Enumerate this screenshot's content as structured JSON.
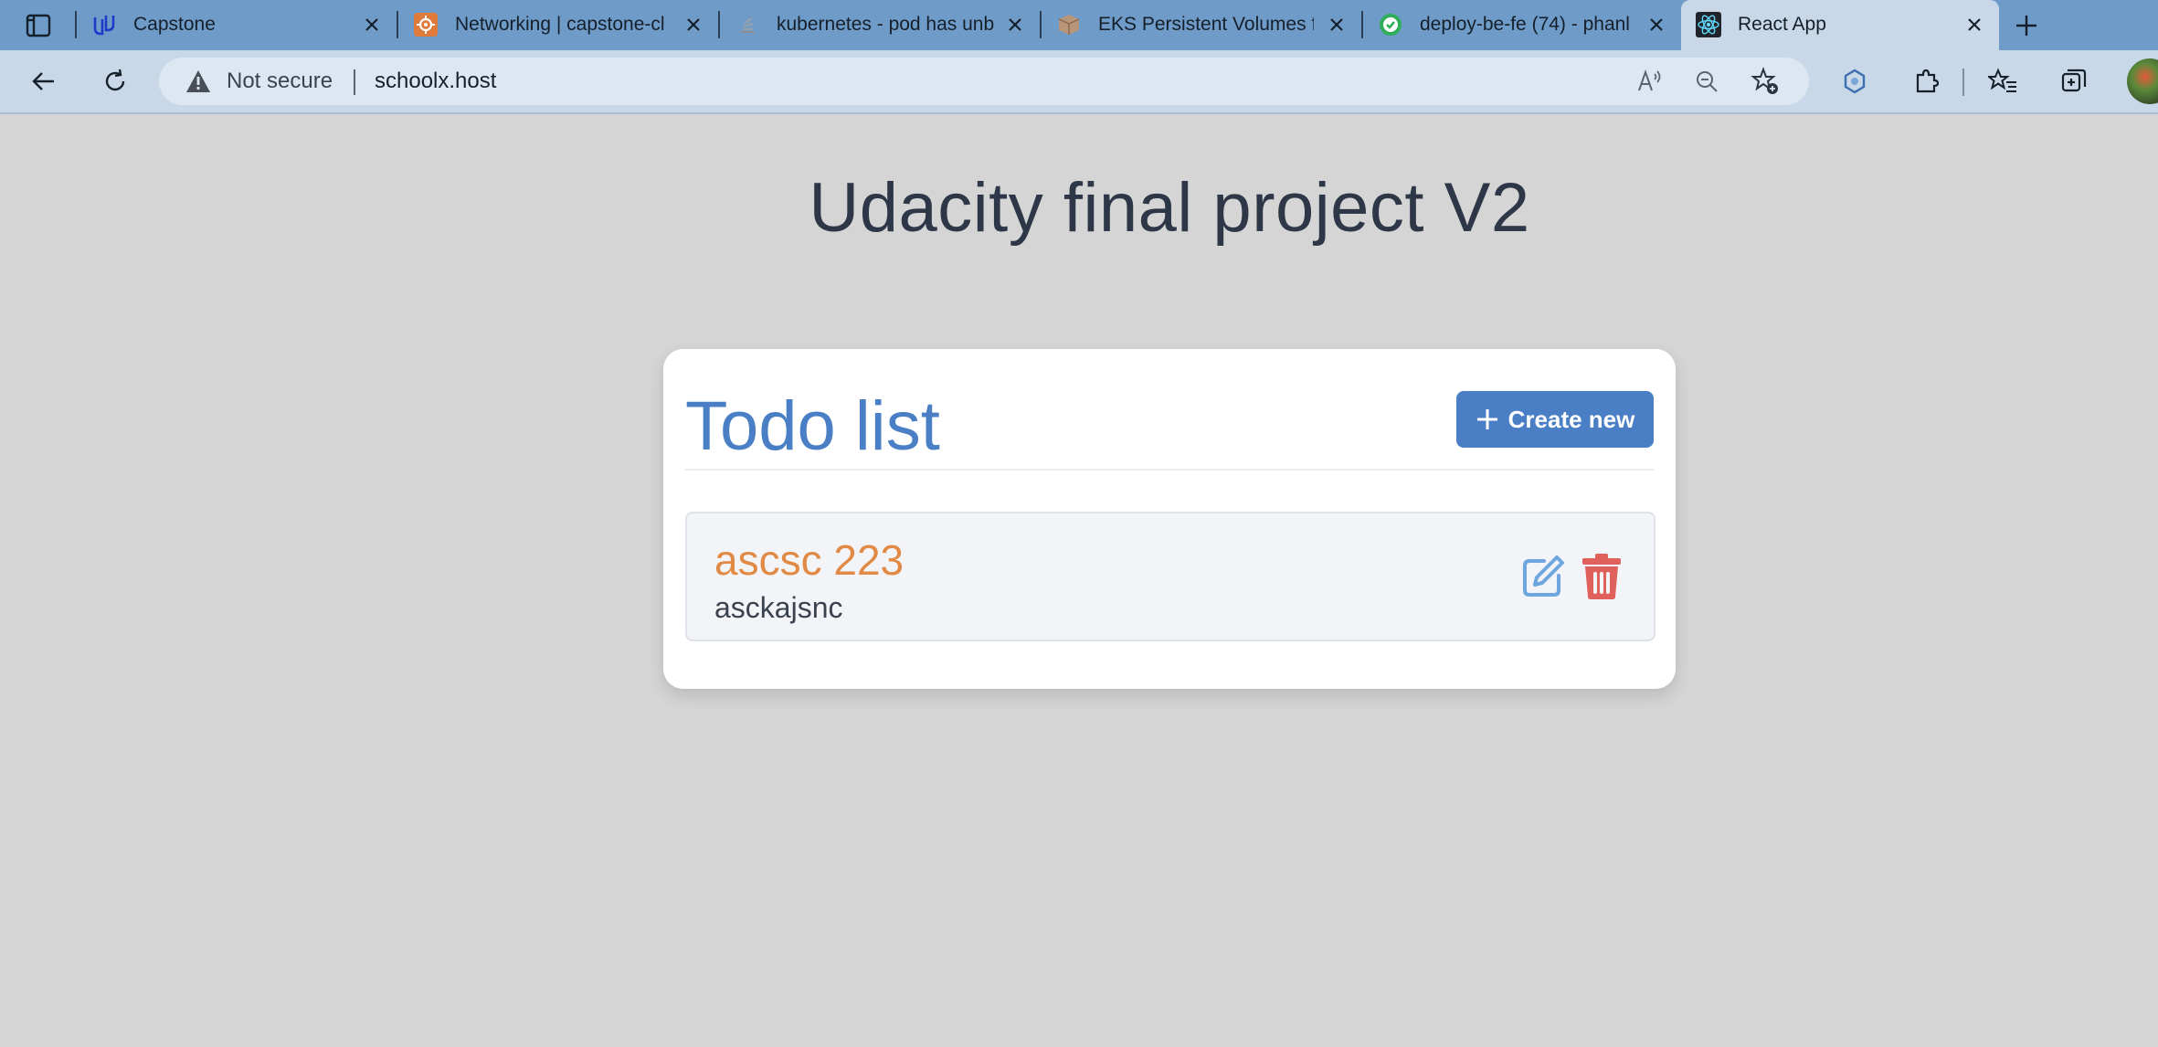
{
  "browser": {
    "tabs": [
      {
        "title": "Capstone",
        "icon": "udacity-icon"
      },
      {
        "title": "Networking | capstone-cl",
        "icon": "networking-icon"
      },
      {
        "title": "kubernetes - pod has unb",
        "icon": "stackoverflow-icon"
      },
      {
        "title": "EKS Persistent Volumes fc",
        "icon": "package-icon"
      },
      {
        "title": "deploy-be-fe (74) - phanl",
        "icon": "circleci-icon"
      },
      {
        "title": "React App",
        "icon": "react-icon",
        "active": true
      }
    ],
    "address_bar": {
      "security_label": "Not secure",
      "url": "schoolx.host"
    }
  },
  "page": {
    "heading": "Udacity final project V2"
  },
  "todo_card": {
    "title": "Todo list",
    "create_button_label": "Create new",
    "items": [
      {
        "title": "ascsc 223",
        "description": "asckajsnc"
      }
    ]
  },
  "colors": {
    "accent": "#4a7fc5",
    "todo_title": "#e08a45",
    "delete": "#e0605b",
    "page_background": "#d4d5d4"
  }
}
